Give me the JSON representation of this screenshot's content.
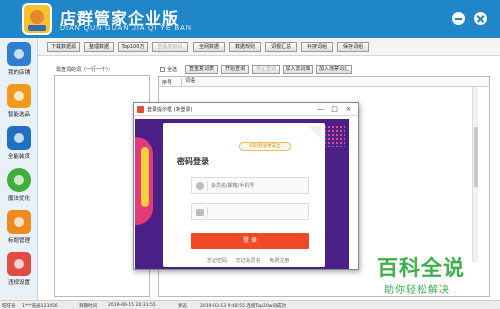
{
  "app": {
    "title": "店群管家企业版",
    "subtitle": "DIAN QUN GUAN JIA QI YE BAN"
  },
  "sidebar": {
    "items": [
      {
        "label": "我的店铺",
        "color": "#2f7fd0"
      },
      {
        "label": "智能选品",
        "color": "#f19a1a"
      },
      {
        "label": "全能装货",
        "color": "#1f6fc5"
      },
      {
        "label": "魔法优化",
        "color": "#3fae3a"
      },
      {
        "label": "标题管理",
        "color": "#f08a1c"
      },
      {
        "label": "违规设置",
        "color": "#e04b44"
      }
    ]
  },
  "toolbar": {
    "buttons": [
      {
        "label": "下载数据源"
      },
      {
        "label": "整理数据"
      },
      {
        "label": "Top100万"
      },
      {
        "label": "查看类目词"
      },
      {
        "label": "全网数据"
      },
      {
        "label": "数据规则"
      },
      {
        "label": "词根汇总"
      },
      {
        "label": "补搜词组"
      },
      {
        "label": "保存词组"
      }
    ]
  },
  "main": {
    "list_label": "需查词的词（一行一个）：",
    "select_all": "全选",
    "actions": [
      {
        "label": "查重复词表"
      },
      {
        "label": "开始查询"
      },
      {
        "label": "停止查询"
      },
      {
        "label": "加入去词库"
      },
      {
        "label": "加入违禁词汇"
      }
    ],
    "columns": [
      "序号",
      "词语"
    ]
  },
  "dialog": {
    "title": "登录提示框 (未登录)",
    "controls": [
      "—",
      "□",
      "×"
    ],
    "qr_tip": "扫码登录更安全",
    "login_title": "密码登录",
    "username_placeholder": "会员名/邮箱/手机号",
    "password_placeholder": "",
    "login_button": "登 录",
    "links": [
      "忘记密码",
      "忘记会员名",
      "免费注册"
    ]
  },
  "status": {
    "account_label": "旺旺号",
    "account_value": "1***浩迪123456",
    "expire_label": "到期时间",
    "expire_value": "2019-06-15 20:31:55",
    "state_label": "状态",
    "state_value": "2019-03-13 9:48:55 连接Top20w词成功"
  },
  "watermark": {
    "big": "百科全说",
    "small": "助你轻松解决"
  }
}
